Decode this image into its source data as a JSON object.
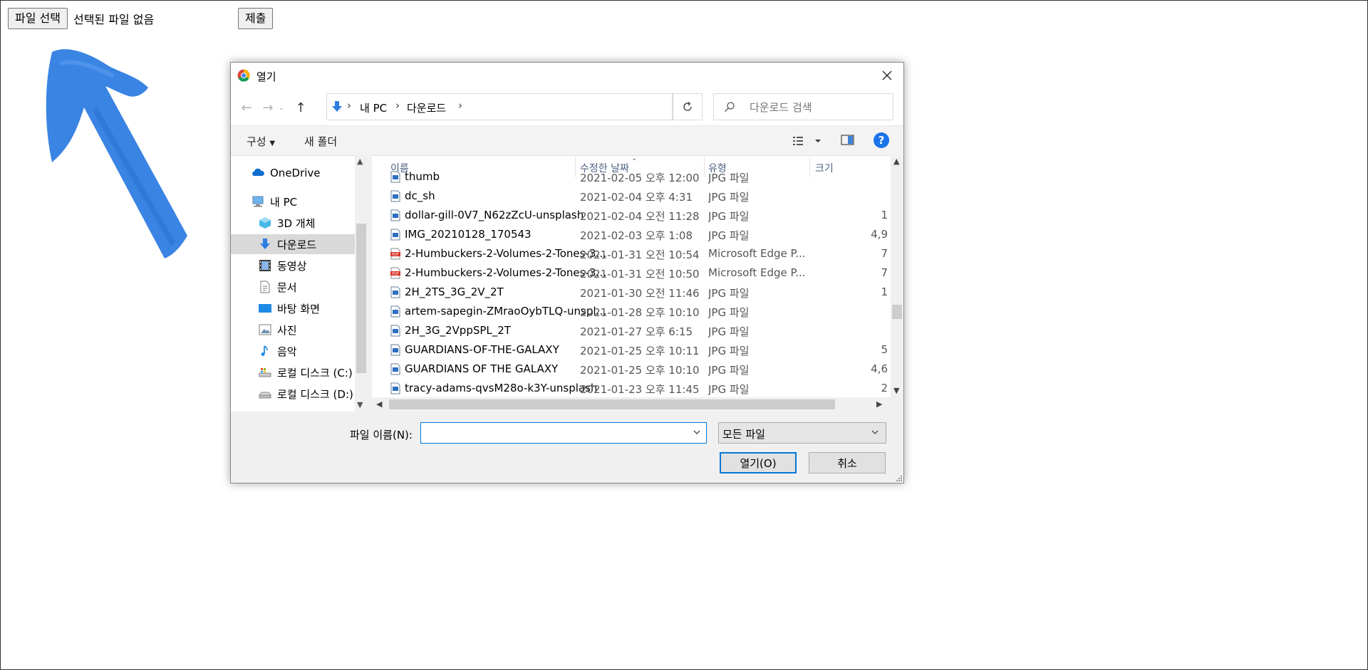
{
  "page": {
    "choose_file_label": "파일 선택",
    "no_file_text": "선택된 파일 없음",
    "submit_label": "제출"
  },
  "dialog": {
    "title": "열기",
    "address": {
      "segments": [
        "내 PC",
        "다운로드"
      ]
    },
    "search_placeholder": "다운로드 검색",
    "toolbar": {
      "organize": "구성",
      "new_folder": "새 폴더"
    },
    "tree": [
      {
        "label": "OneDrive",
        "icon": "cloud-icon"
      },
      {
        "label": "내 PC",
        "icon": "computer-icon"
      },
      {
        "label": "3D 개체",
        "icon": "cube-icon"
      },
      {
        "label": "다운로드",
        "icon": "download-icon",
        "selected": true
      },
      {
        "label": "동영상",
        "icon": "video-icon"
      },
      {
        "label": "문서",
        "icon": "document-icon"
      },
      {
        "label": "바탕 화면",
        "icon": "desktop-icon"
      },
      {
        "label": "사진",
        "icon": "picture-icon"
      },
      {
        "label": "음악",
        "icon": "music-icon"
      },
      {
        "label": "로컬 디스크 (C:)",
        "icon": "drive-icon"
      },
      {
        "label": "로컬 디스크 (D:)",
        "icon": "drive-icon"
      }
    ],
    "columns": {
      "name": "이름",
      "date": "수정한 날짜",
      "type": "유형",
      "size": "크기"
    },
    "files": [
      {
        "name": "thumb",
        "date": "2021-02-05 오후 12:00",
        "type": "JPG 파일",
        "size": "",
        "kind": "image"
      },
      {
        "name": "dc_sh",
        "date": "2021-02-04 오후 4:31",
        "type": "JPG 파일",
        "size": "",
        "kind": "image"
      },
      {
        "name": "dollar-gill-0V7_N62zZcU-unsplash",
        "date": "2021-02-04 오전 11:28",
        "type": "JPG 파일",
        "size": "1",
        "kind": "image"
      },
      {
        "name": "IMG_20210128_170543",
        "date": "2021-02-03 오후 1:08",
        "type": "JPG 파일",
        "size": "4,9",
        "kind": "image"
      },
      {
        "name": "2-Humbuckers-2-Volumes-2-Tones-3-W...",
        "date": "2021-01-31 오전 10:54",
        "type": "Microsoft Edge P...",
        "size": "7",
        "kind": "pdf"
      },
      {
        "name": "2-Humbuckers-2-Volumes-2-Tones-3-W...",
        "date": "2021-01-31 오전 10:50",
        "type": "Microsoft Edge P...",
        "size": "7",
        "kind": "pdf"
      },
      {
        "name": "2H_2TS_3G_2V_2T",
        "date": "2021-01-30 오전 11:46",
        "type": "JPG 파일",
        "size": "1",
        "kind": "image"
      },
      {
        "name": "artem-sapegin-ZMraoOybTLQ-unsplash",
        "date": "2021-01-28 오후 10:10",
        "type": "JPG 파일",
        "size": "",
        "kind": "image"
      },
      {
        "name": "2H_3G_2VppSPL_2T",
        "date": "2021-01-27 오후 6:15",
        "type": "JPG 파일",
        "size": "",
        "kind": "image"
      },
      {
        "name": "GUARDIANS-OF-THE-GALAXY",
        "date": "2021-01-25 오후 10:11",
        "type": "JPG 파일",
        "size": "5",
        "kind": "image"
      },
      {
        "name": "GUARDIANS OF THE GALAXY",
        "date": "2021-01-25 오후 10:10",
        "type": "JPG 파일",
        "size": "4,6",
        "kind": "image"
      },
      {
        "name": "tracy-adams-qvsM28o-k3Y-unsplash",
        "date": "2021-01-23 오후 11:45",
        "type": "JPG 파일",
        "size": "2",
        "kind": "image"
      }
    ],
    "filename_label": "파일 이름(N):",
    "filename_value": "",
    "filetype_value": "모든 파일",
    "open_label": "열기(O)",
    "cancel_label": "취소"
  },
  "colors": {
    "accent": "#0078d7",
    "arrow": "#2f7de1"
  }
}
